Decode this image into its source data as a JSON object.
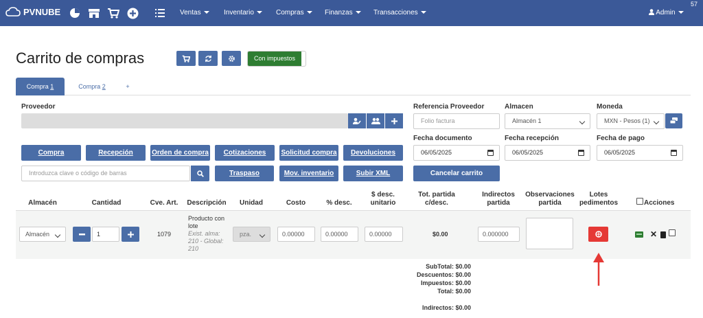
{
  "nav": {
    "brand": "PVNUBE",
    "menus": [
      "Ventas",
      "Inventario",
      "Compras",
      "Finanzas",
      "Transacciones"
    ],
    "user": "Admin",
    "counter": "57",
    "icons": [
      "cloud-logo-icon",
      "pie-chart-icon",
      "store-icon",
      "cart-icon",
      "plus-circle-icon",
      "list-icon"
    ]
  },
  "page": {
    "title": "Carrito de compras",
    "tax_toggle": "Con impuestos"
  },
  "tabs": [
    {
      "prefix": "Compra ",
      "num": "1"
    },
    {
      "prefix": "Compra ",
      "num": "2"
    },
    {
      "prefix": "+",
      "num": ""
    }
  ],
  "form": {
    "proveedor_label": "Proveedor",
    "ref_label": "Referencia Proveedor",
    "ref_placeholder": "Folio factura",
    "almacen_label": "Almacen",
    "almacen_value": "Almacén 1",
    "moneda_label": "Moneda",
    "moneda_value": "MXN - Pesos (1)",
    "fecha_doc_label": "Fecha documento",
    "fecha_doc_value": "06/05/2025",
    "fecha_rec_label": "Fecha recepción",
    "fecha_rec_value": "06/05/2025",
    "fecha_pago_label": "Fecha de pago",
    "fecha_pago_value": "06/05/2025",
    "search_placeholder": "Introduzca clave o código de barras"
  },
  "actions": {
    "compra": "Compra",
    "recepcion": "Recepción",
    "orden": "Orden de compra",
    "cotizaciones": "Cotizaciones",
    "solicitud": "Solicitud compra",
    "devoluciones": "Devoluciones",
    "traspaso": "Traspaso",
    "mov_inventario": "Mov. inventario",
    "subir_xml": "Subir XML",
    "cancelar": "Cancelar carrito"
  },
  "table": {
    "headers": {
      "almacen": "Almacén",
      "cantidad": "Cantidad",
      "cve": "Cve. Art.",
      "descripcion": "Descripción",
      "unidad": "Unidad",
      "costo": "Costo",
      "pct_desc": "% desc.",
      "desc_unit_1": "$ desc.",
      "desc_unit_2": "unitario",
      "tot_1": "Tot. partida",
      "tot_2": "c/desc.",
      "ind_1": "Indirectos",
      "ind_2": "partida",
      "obs_1": "Observaciones",
      "obs_2": "partida",
      "lotes_1": "Lotes",
      "lotes_2": "pedimentos",
      "acciones": "Acciones"
    },
    "row": {
      "almacen": "Almacén",
      "cantidad": "1",
      "cve": "1079",
      "desc_1": "Producto con",
      "desc_2": "lote",
      "stock_1": "Exist. alma:",
      "stock_2": "210 - Global:",
      "stock_3": "210",
      "unidad": "pza.",
      "costo": "0.00000",
      "pct_desc": "0.00000",
      "desc_unit": "0.00000",
      "total": "$0.00",
      "indirectos": "0.000000"
    }
  },
  "totals": {
    "subtotal": "SubTotal: $0.00",
    "descuentos": "Descuentos: $0.00",
    "impuestos": "Impuestos: $0.00",
    "total": "Total: $0.00",
    "indirectos": "Indirectos: $0.00"
  },
  "colors": {
    "navbar": "#3b5998",
    "button": "#4a6da7",
    "toggle_on": "#2e7d32",
    "lotes_button": "#e53935",
    "annotation_arrow": "#e53935"
  }
}
